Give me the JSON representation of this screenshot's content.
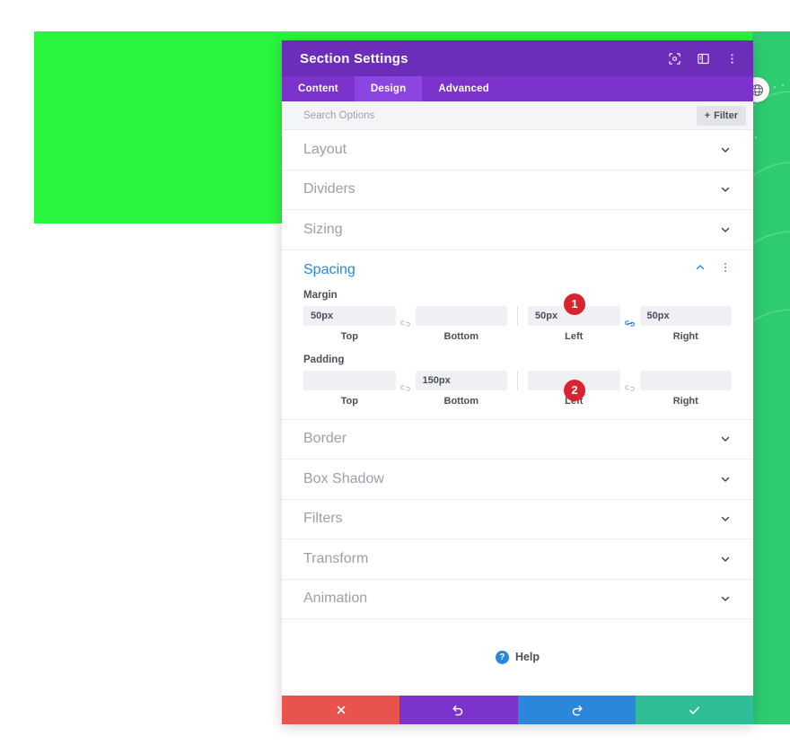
{
  "colors": {
    "header_purple": "#6c2eb9",
    "tabs_purple": "#7b33cc",
    "tab_active_purple": "#8c45e0",
    "accent_blue": "#2b87da",
    "badge_red": "#d9232e",
    "cancel_red": "#e9534d",
    "undo_purple": "#7b33cc",
    "redo_blue": "#2b87da",
    "save_green": "#2ebd96",
    "canvas_bright_green": "#2af53e",
    "canvas_side_green": "#2ecc71"
  },
  "canvas": {
    "globe_icon": "globe-icon"
  },
  "modal": {
    "title": "Section Settings",
    "header_icons": [
      {
        "name": "focus-target-icon"
      },
      {
        "name": "panel-layout-icon"
      },
      {
        "name": "more-vertical-icon"
      }
    ],
    "tabs": [
      {
        "label": "Content",
        "active": false
      },
      {
        "label": "Design",
        "active": true
      },
      {
        "label": "Advanced",
        "active": false
      }
    ],
    "search": {
      "placeholder": "Search Options",
      "value": "",
      "filter_label": "Filter",
      "filter_icon": "plus-icon"
    },
    "sections_top": [
      {
        "label": "Layout",
        "icon": "chevron-down-icon"
      },
      {
        "label": "Dividers",
        "icon": "chevron-down-icon"
      },
      {
        "label": "Sizing",
        "icon": "chevron-down-icon"
      }
    ],
    "spacing": {
      "title": "Spacing",
      "collapse_icon": "chevron-up-icon",
      "menu_icon": "more-vertical-icon",
      "margin": {
        "label": "Margin",
        "badge": "1",
        "top": {
          "value": "50px",
          "label": "Top"
        },
        "bottom": {
          "value": "",
          "label": "Bottom"
        },
        "left": {
          "value": "50px",
          "label": "Left"
        },
        "right": {
          "value": "50px",
          "label": "Right"
        },
        "link_left_icon": "chain-unlinked-icon",
        "link_right_icon": "chain-linked-icon"
      },
      "padding": {
        "label": "Padding",
        "badge": "2",
        "top": {
          "value": "",
          "label": "Top"
        },
        "bottom": {
          "value": "150px",
          "label": "Bottom"
        },
        "left": {
          "value": "",
          "label": "Left"
        },
        "right": {
          "value": "",
          "label": "Right"
        },
        "link_left_icon": "chain-unlinked-icon",
        "link_right_icon": "chain-unlinked-icon"
      }
    },
    "sections_bottom": [
      {
        "label": "Border",
        "icon": "chevron-down-icon"
      },
      {
        "label": "Box Shadow",
        "icon": "chevron-down-icon"
      },
      {
        "label": "Filters",
        "icon": "chevron-down-icon"
      },
      {
        "label": "Transform",
        "icon": "chevron-down-icon"
      },
      {
        "label": "Animation",
        "icon": "chevron-down-icon"
      }
    ],
    "help": {
      "label": "Help",
      "icon": "question-circle-icon"
    },
    "footer": [
      {
        "name": "cancel-button",
        "icon": "close-x-icon"
      },
      {
        "name": "undo-button",
        "icon": "undo-arrow-icon"
      },
      {
        "name": "redo-button",
        "icon": "redo-arrow-icon"
      },
      {
        "name": "save-button",
        "icon": "checkmark-icon"
      }
    ]
  }
}
